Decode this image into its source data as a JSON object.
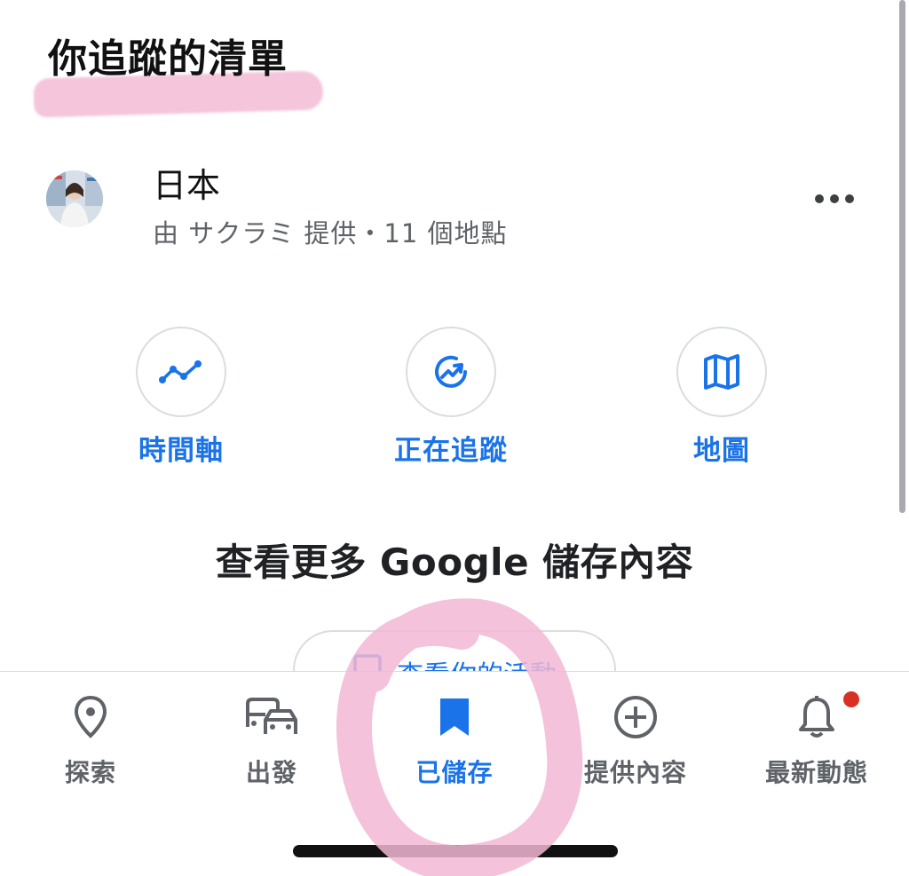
{
  "section": {
    "title": "你追蹤的清單"
  },
  "list": {
    "title": "日本",
    "subtitle": "由 サクラミ 提供・11 個地點"
  },
  "actions": [
    {
      "label": "時間軸",
      "icon": "timeline-icon"
    },
    {
      "label": "正在追蹤",
      "icon": "following-icon"
    },
    {
      "label": "地圖",
      "icon": "map-icon"
    }
  ],
  "more": {
    "heading": "查看更多 Google 儲存內容",
    "button_label": "查看你的活動"
  },
  "nav": {
    "items": [
      {
        "label": "探索",
        "icon": "location-pin-icon"
      },
      {
        "label": "出發",
        "icon": "commute-icon"
      },
      {
        "label": "已儲存",
        "icon": "bookmark-icon",
        "active": true
      },
      {
        "label": "提供內容",
        "icon": "add-circle-icon"
      },
      {
        "label": "最新動態",
        "icon": "bell-icon",
        "badge": true
      }
    ]
  },
  "colors": {
    "accent": "#1a73e8",
    "text_secondary": "#5f6368",
    "highlight_pink": "#f2b7d3",
    "badge_red": "#d93025"
  }
}
